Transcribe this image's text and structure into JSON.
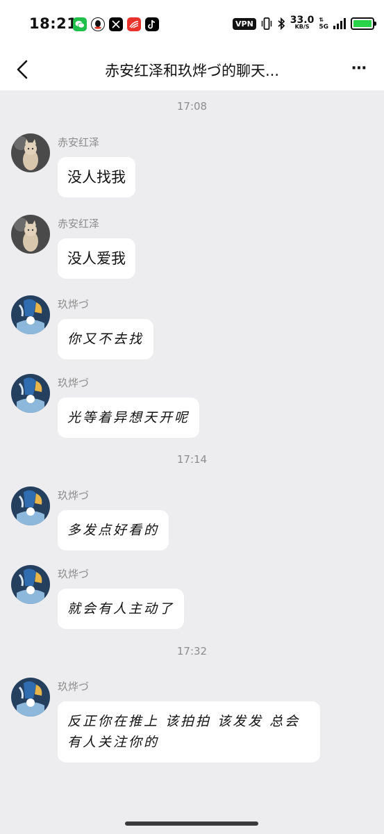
{
  "status_bar": {
    "time": "18:21",
    "app_icons": [
      "wechat-icon",
      "qq-icon",
      "x-icon",
      "news-icon",
      "tiktok-icon"
    ],
    "vpn": "VPN",
    "speed_value": "33.0",
    "speed_unit": "KB/S",
    "network": "5G",
    "battery_color": "#2bd34a"
  },
  "navbar": {
    "title": "赤安红泽和玖烨づ的聊天...",
    "more": "⋯"
  },
  "chat": {
    "timestamps": [
      "17:08",
      "17:14",
      "17:32"
    ],
    "messages": [
      {
        "sender": "赤安红泽",
        "text": "没人找我"
      },
      {
        "sender": "赤安红泽",
        "text": "没人爱我"
      },
      {
        "sender": "玖烨づ",
        "text": "你又不去找"
      },
      {
        "sender": "玖烨づ",
        "text": "光等着异想天开呢"
      },
      {
        "sender": "玖烨づ",
        "text": "多发点好看的"
      },
      {
        "sender": "玖烨づ",
        "text": "就会有人主动了"
      },
      {
        "sender": "玖烨づ",
        "line1": "反正你在推上 该拍拍 该发发 总会",
        "line2": "有人关注你的"
      }
    ]
  },
  "colors": {
    "background": "#ededef",
    "bubble": "#ffffff",
    "meta_text": "#8c8c8c"
  }
}
